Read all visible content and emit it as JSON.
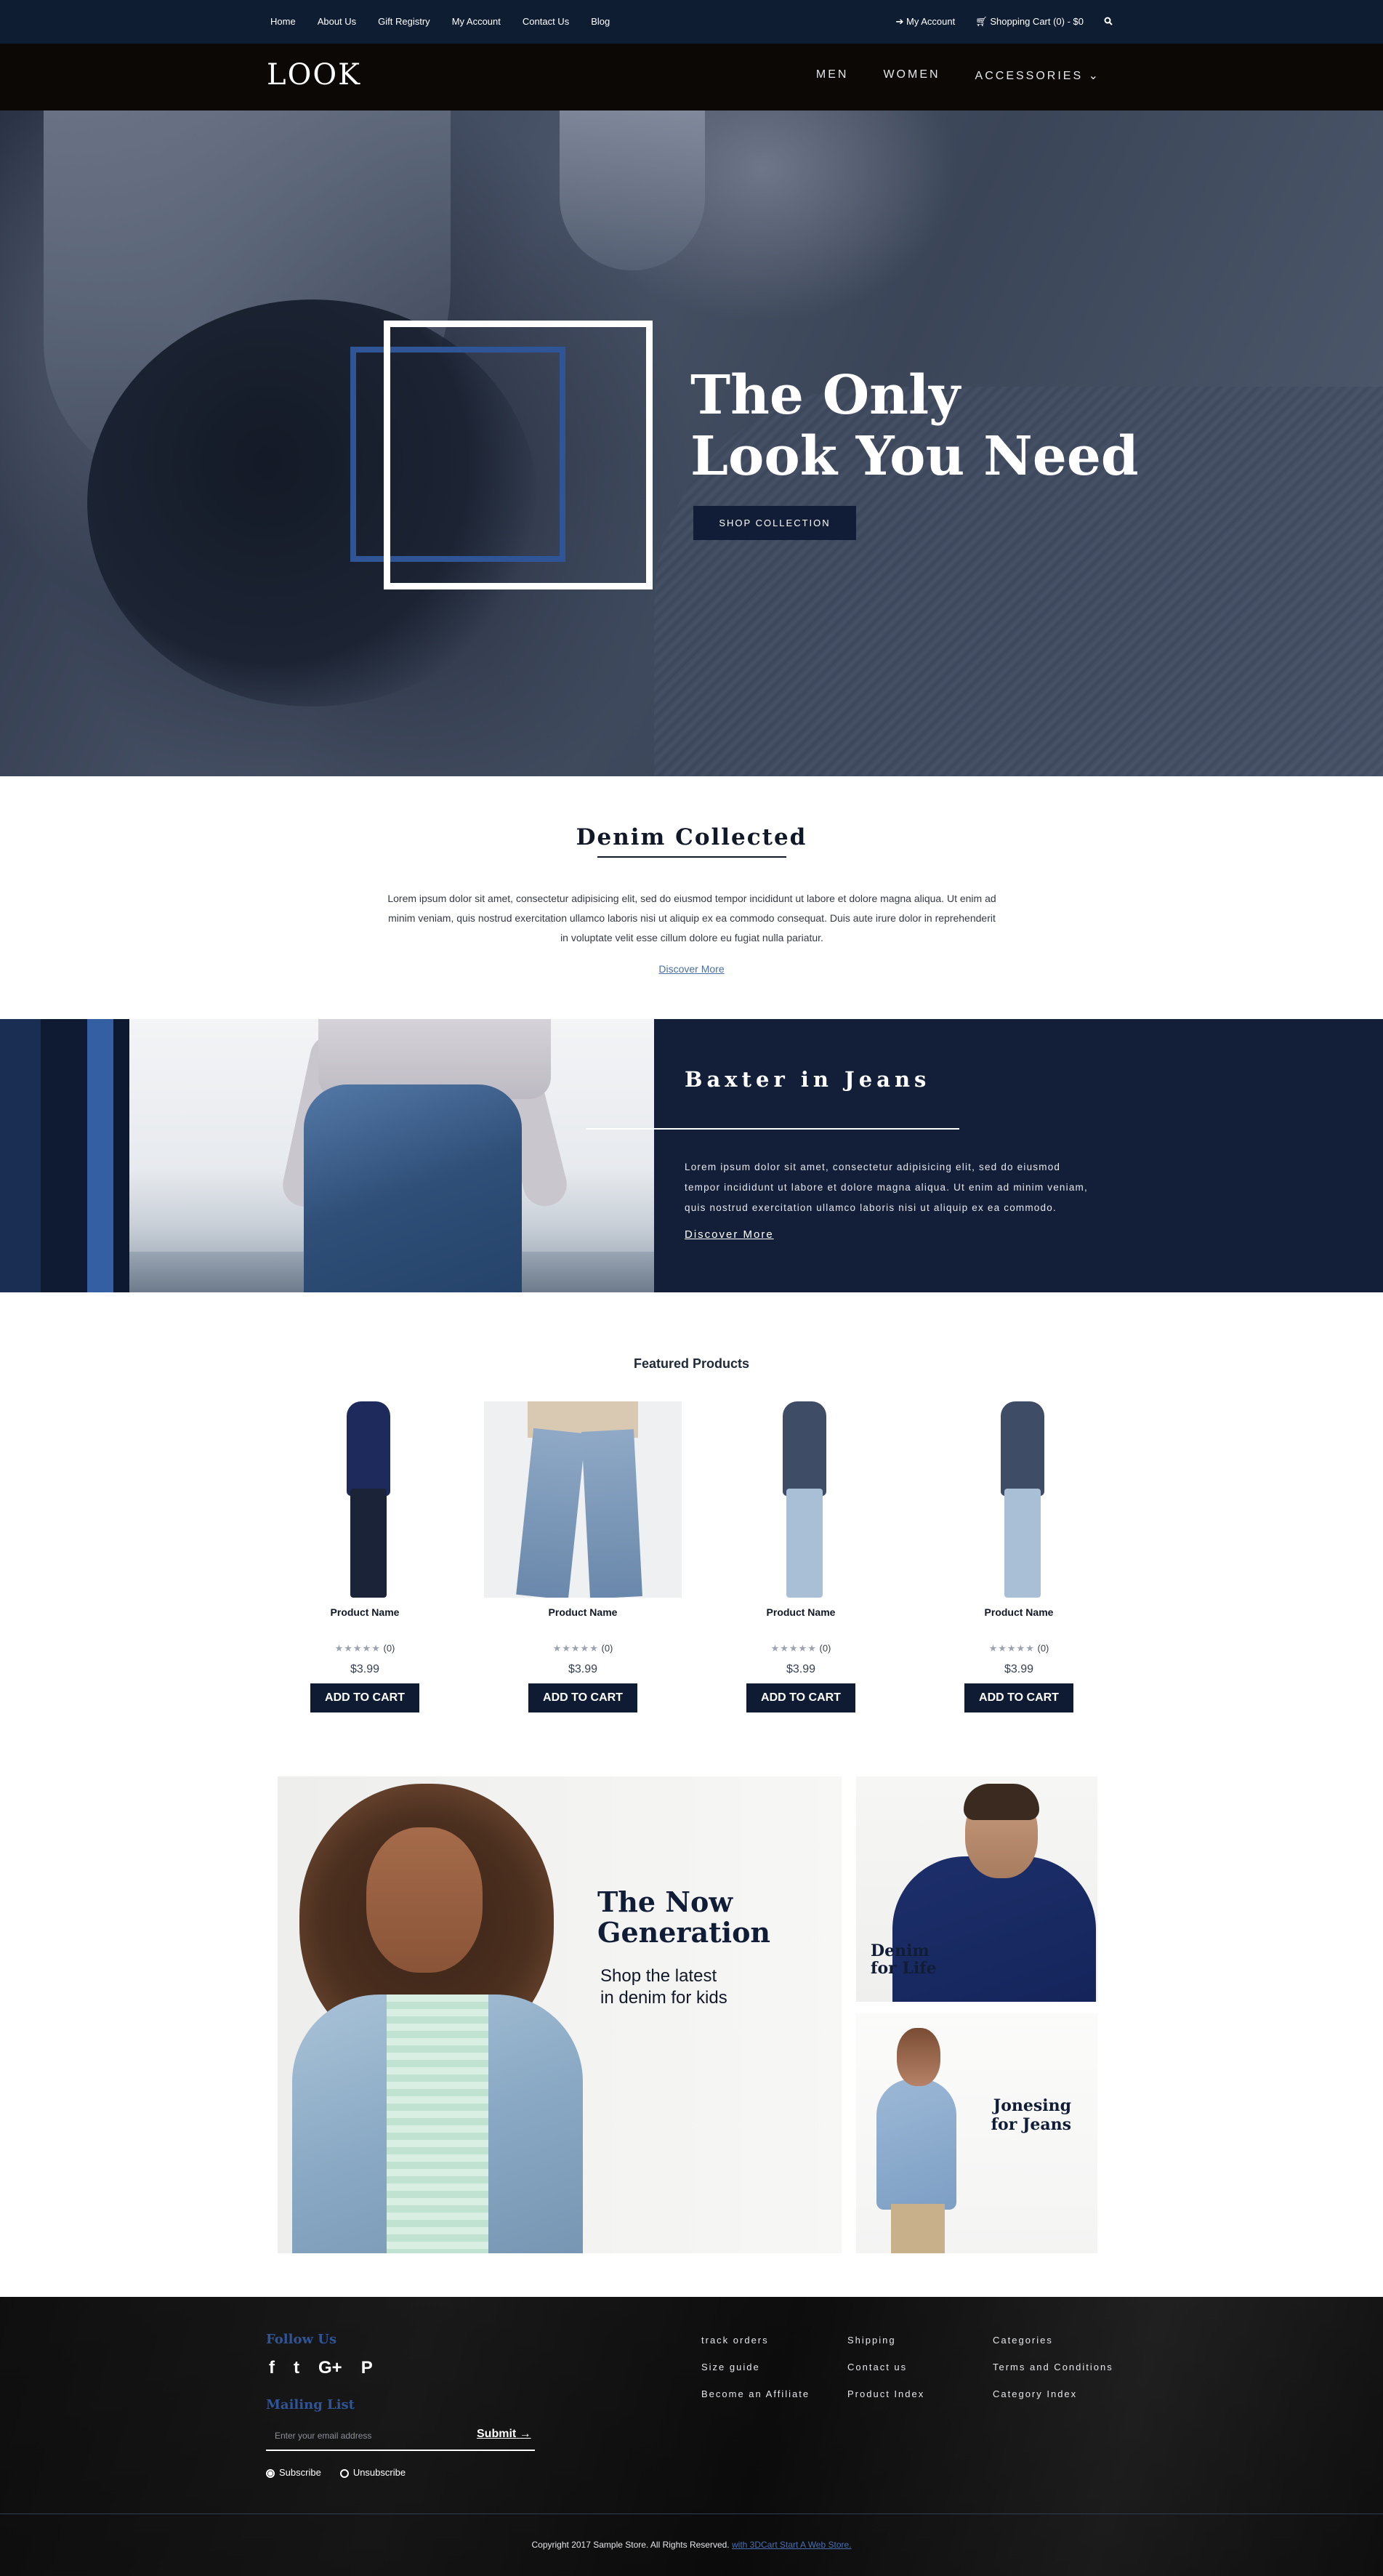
{
  "topbar": {
    "links": [
      "Home",
      "About Us",
      "Gift Registry",
      "My Account",
      "Contact Us",
      "Blog"
    ],
    "account": "My Account",
    "cart": "Shopping Cart (0) - $0"
  },
  "header": {
    "logo": "LOOK",
    "nav": [
      "MEN",
      "WOMEN",
      "ACCESSORIES"
    ]
  },
  "hero": {
    "title_line1": "The Only",
    "title_line2": "Look You Need",
    "cta": "SHOP COLLECTION"
  },
  "intro": {
    "title": "Denim Collected",
    "body": "Lorem ipsum dolor sit amet, consectetur adipisicing elit, sed do eiusmod tempor incididunt ut labore et dolore magna aliqua. Ut enim ad minim veniam, quis nostrud exercitation ullamco laboris nisi ut aliquip ex ea commodo consequat. Duis aute irure dolor in reprehenderit in voluptate velit esse cillum dolore eu fugiat nulla pariatur.",
    "link": "Discover More"
  },
  "baxter": {
    "title": "Baxter in Jeans",
    "body": "Lorem ipsum dolor sit amet, consectetur adipisicing elit, sed do eiusmod tempor incididunt ut labore et dolore magna aliqua. Ut enim ad minim veniam, quis nostrud exercitation ullamco laboris nisi ut aliquip ex ea commodo.",
    "link": "Discover More"
  },
  "featured": {
    "title": "Featured Products",
    "products": [
      {
        "name": "Product Name",
        "stars": "★★★★★",
        "reviews": "(0)",
        "price": "$3.99",
        "button": "ADD TO CART"
      },
      {
        "name": "Product Name",
        "stars": "★★★★★",
        "reviews": "(0)",
        "price": "$3.99",
        "button": "ADD TO CART"
      },
      {
        "name": "Product Name",
        "stars": "★★★★★",
        "reviews": "(0)",
        "price": "$3.99",
        "button": "ADD TO CART"
      },
      {
        "name": "Product Name",
        "stars": "★★★★★",
        "reviews": "(0)",
        "price": "$3.99",
        "button": "ADD TO CART"
      }
    ]
  },
  "promo": {
    "main_title_line1": "The Now",
    "main_title_line2": "Generation",
    "main_sub_line1": "Shop the latest",
    "main_sub_line2": "in denim for kids",
    "a_line1": "Denim",
    "a_line2": "for Life",
    "b_line1": "Jonesing",
    "b_line2": "for Jeans"
  },
  "footer": {
    "follow": "Follow Us",
    "social_icons": [
      "facebook-icon",
      "twitter-icon",
      "google-plus-icon",
      "pinterest-icon"
    ],
    "social_glyphs": [
      "f",
      "t",
      "G+",
      "P"
    ],
    "mailing": "Mailing List",
    "email_placeholder": "Enter your email address",
    "submit": "Submit",
    "subscribe": "Subscribe",
    "unsubscribe": "Unsubscribe",
    "col1": [
      "track orders",
      "Size guide",
      "Become an Affiliate"
    ],
    "col2": [
      "Shipping",
      "Contact us",
      "Product Index"
    ],
    "col3": [
      "Categories",
      "Terms and Conditions",
      "Category Index"
    ],
    "copyright": "Copyright 2017 Sample Store. All Rights Reserved.",
    "copyright_link": "with 3DCart Start A Web Store."
  },
  "colors": {
    "navy": "#0f1d33",
    "accent_blue": "#2f5597",
    "header_black": "#0c0806"
  }
}
